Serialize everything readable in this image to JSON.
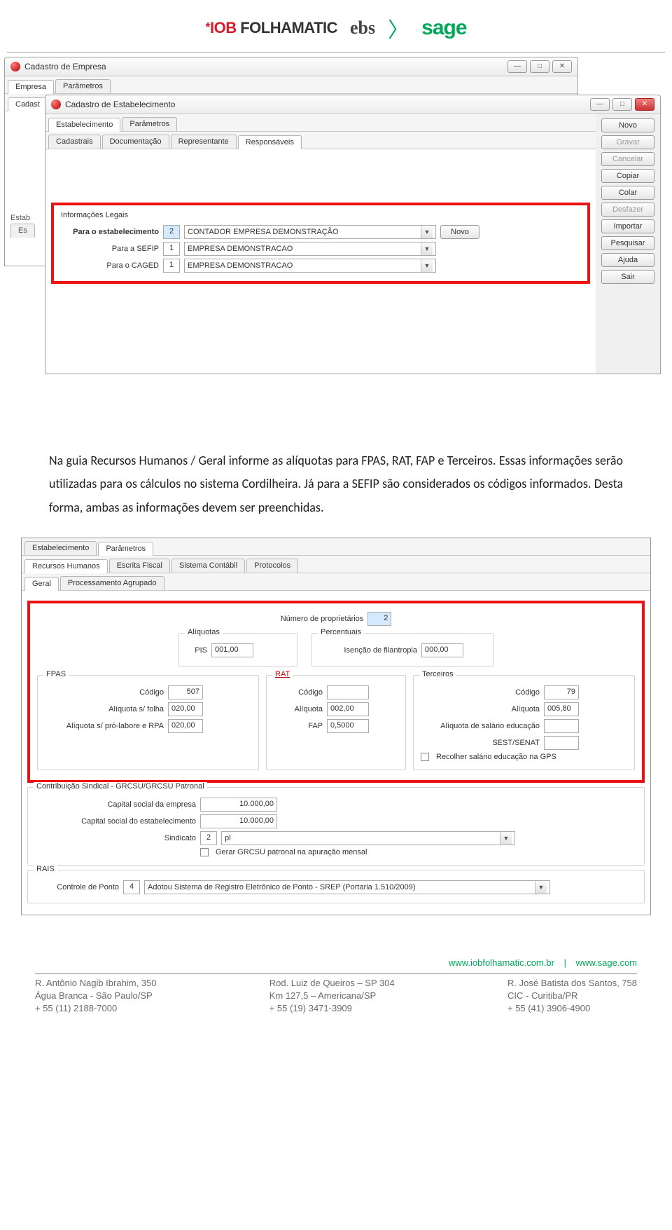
{
  "logos": {
    "iob_prefix": "*",
    "iob_brand": "IOB",
    "iob_suffix": "FOLHAMATIC",
    "ebs": "ebs",
    "angle": "〉",
    "sage": "sage"
  },
  "window1": {
    "title": "Cadastro de Empresa",
    "tabs_top": [
      "Empresa",
      "Parâmetros"
    ],
    "tabs_sub": [
      "Cadast"
    ],
    "side_label1": "Estab",
    "side_label2": "Es"
  },
  "window2": {
    "title": "Cadastro de Estabelecimento",
    "tabs_top": [
      "Estabelecimento",
      "Parâmetros"
    ],
    "tabs_sub": [
      "Cadastrais",
      "Documentação",
      "Representante",
      "Responsáveis"
    ],
    "side_buttons": [
      "Novo",
      "Gravar",
      "Cancelar",
      "Copiar",
      "Colar",
      "Desfazer",
      "Importar",
      "Pesquisar",
      "Ajuda",
      "Sair"
    ],
    "legal": {
      "legend": "Informações Legais",
      "row1": {
        "label": "Para o estabelecimento",
        "code": "2",
        "desc": "CONTADOR EMPRESA DEMONSTRAÇÃO",
        "btn": "Novo"
      },
      "row2": {
        "label": "Para a SEFIP",
        "code": "1",
        "desc": "EMPRESA DEMONSTRACAO"
      },
      "row3": {
        "label": "Para o CAGED",
        "code": "1",
        "desc": "EMPRESA DEMONSTRACAO"
      }
    }
  },
  "paragraph": "Na guia Recursos Humanos / Geral informe as alíquotas para FPAS, RAT, FAP e Terceiros. Essas informações serão utilizadas para os cálculos no sistema Cordilheira. Já para a SEFIP são considerados os códigos informados. Desta forma, ambas as informações devem ser preenchidas.",
  "params": {
    "tabs_top": [
      "Estabelecimento",
      "Parâmetros"
    ],
    "tabs_mid": [
      "Recursos Humanos",
      "Escrita Fiscal",
      "Sistema Contábil",
      "Protocolos"
    ],
    "tabs_low": [
      "Geral",
      "Processamento Agrupado"
    ],
    "num_prop_label": "Número de proprietários",
    "num_prop_value": "2",
    "aliq_legend": "Alíquotas",
    "pis_label": "PIS",
    "pis_value": "001,00",
    "perc_legend": "Percentuais",
    "isen_label": "Isenção de filantropia",
    "isen_value": "000,00",
    "fpas": {
      "legend": "FPAS",
      "codigo_label": "Código",
      "codigo": "507",
      "aliq_folha_label": "Alíquota s/ folha",
      "aliq_folha": "020,00",
      "aliq_pro_label": "Alíquota s/ pró-labore e RPA",
      "aliq_pro": "020,00"
    },
    "rat": {
      "legend": "RAT",
      "codigo_label": "Código",
      "codigo": "",
      "aliq_label": "Alíquota",
      "aliq": "002,00",
      "fap_label": "FAP",
      "fap": "0,5000"
    },
    "terc": {
      "legend": "Terceiros",
      "codigo_label": "Código",
      "codigo": "79",
      "aliq_label": "Alíquota",
      "aliq": "005,80",
      "aliq_edu_label": "Alíquota de salário educação",
      "aliq_edu": "",
      "sest_label": "SEST/SENAT",
      "sest": "",
      "recolher_label": "Recolher salário educação na GPS"
    },
    "sindical": {
      "legend": "Contribuição Sindical - GRCSU/GRCSU Patronal",
      "cap_emp_label": "Capital social da empresa",
      "cap_emp": "10.000,00",
      "cap_est_label": "Capital social do estabelecimento",
      "cap_est": "10.000,00",
      "sind_label": "Sindicato",
      "sind_code": "2",
      "sind_desc": "pl",
      "gerar_label": "Gerar GRCSU patronal na apuração mensal"
    },
    "rais": {
      "legend": "RAIS",
      "ctrl_label": "Controle de Ponto",
      "ctrl_code": "4",
      "ctrl_desc": "Adotou Sistema de Registro Eletrônico de Ponto - SREP (Portaria 1.510/2009)"
    }
  },
  "footer": {
    "link1": "www.iobfolhamatic.com.br",
    "sep": "|",
    "link2": "www.sage.com",
    "col1": [
      "R. Antônio Nagib Ibrahim, 350",
      "Água Branca - São Paulo/SP",
      "+ 55 (11) 2188-7000"
    ],
    "col2": [
      "Rod. Luiz de Queiros – SP 304",
      "Km 127,5 – Americana/SP",
      "+ 55 (19) 3471-3909"
    ],
    "col3": [
      "R. José Batista dos Santos, 758",
      "CIC - Curitiba/PR",
      "+ 55 (41) 3906-4900"
    ]
  }
}
